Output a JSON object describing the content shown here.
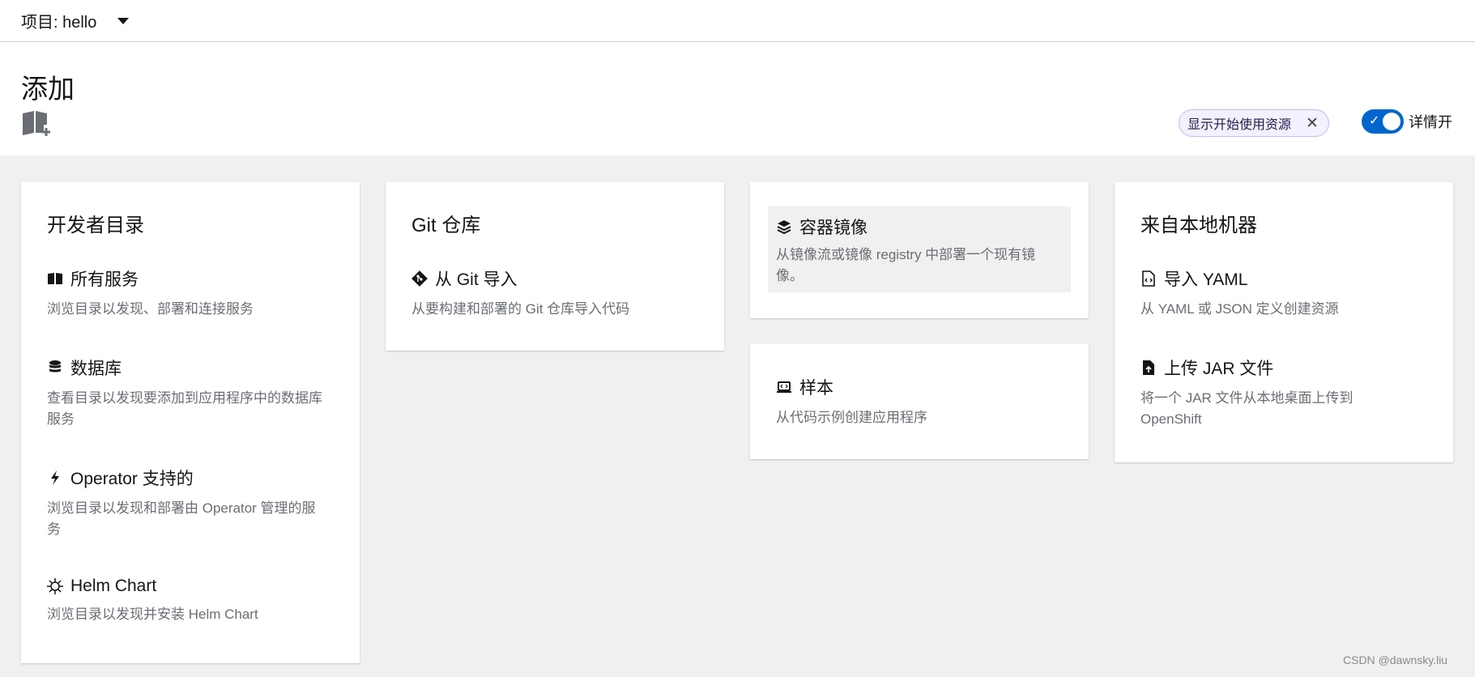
{
  "topbar": {
    "project_label": "项目: hello"
  },
  "header": {
    "title": "添加"
  },
  "getting_started_chip": {
    "label": "显示开始使用资源"
  },
  "details_toggle": {
    "label": "详情开",
    "on": true
  },
  "accent_color": "#0066cc",
  "cards": {
    "developer_catalog": {
      "title": "开发者目录",
      "items": [
        {
          "icon": "catalog-book-icon",
          "title": "所有服务",
          "desc": "浏览目录以发现、部署和连接服务"
        },
        {
          "icon": "database-icon",
          "title": "数据库",
          "desc": "查看目录以发现要添加到应用程序中的数据库服务"
        },
        {
          "icon": "bolt-icon",
          "title": "Operator 支持的",
          "desc": "浏览目录以发现和部署由 Operator 管理的服务"
        },
        {
          "icon": "helm-icon",
          "title": "Helm Chart",
          "desc": "浏览目录以发现并安装 Helm Chart"
        }
      ]
    },
    "git_repository": {
      "title": "Git 仓库",
      "items": [
        {
          "icon": "git-icon",
          "title": "从 Git 导入",
          "desc": "从要构建和部署的 Git 仓库导入代码"
        }
      ]
    },
    "container_image": {
      "items": [
        {
          "icon": "layers-icon",
          "title": "容器镜像",
          "desc": "从镜像流或镜像 registry 中部署一个现有镜像。"
        }
      ]
    },
    "samples": {
      "items": [
        {
          "icon": "laptop-code-icon",
          "title": "样本",
          "desc": "从代码示例创建应用程序"
        }
      ]
    },
    "from_local_machine": {
      "title": "来自本地机器",
      "items": [
        {
          "icon": "file-code-icon",
          "title": "导入 YAML",
          "desc": "从 YAML 或 JSON 定义创建资源"
        },
        {
          "icon": "file-upload-icon",
          "title": "上传 JAR 文件",
          "desc": "将一个 JAR 文件从本地桌面上传到 OpenShift"
        }
      ]
    }
  },
  "watermark": "CSDN @dawnsky.liu"
}
